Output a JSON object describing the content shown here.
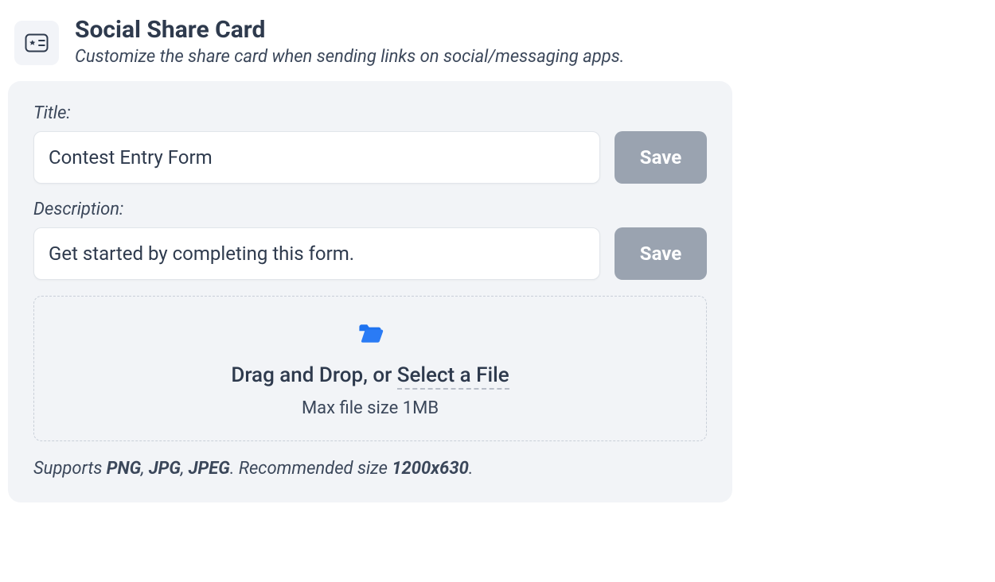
{
  "header": {
    "title": "Social Share Card",
    "subtitle": "Customize the share card when sending links on social/messaging apps.",
    "icon": "card-with-star-icon"
  },
  "panel": {
    "title_field": {
      "label": "Title:",
      "value": "Contest Entry Form",
      "save_label": "Save"
    },
    "description_field": {
      "label": "Description:",
      "value": "Get started by completing this form.",
      "save_label": "Save"
    },
    "dropzone": {
      "icon": "folder-open-icon",
      "line_prefix": "Drag and Drop, or ",
      "select_text": "Select a File",
      "max_size": "Max file size 1MB"
    },
    "support": {
      "prefix": "Supports ",
      "fmt1": "PNG",
      "sep1": ", ",
      "fmt2": "JPG",
      "sep2": ", ",
      "fmt3": "JPEG",
      "after_formats": ". Recommended size ",
      "rec_size": "1200x630",
      "suffix": "."
    }
  }
}
